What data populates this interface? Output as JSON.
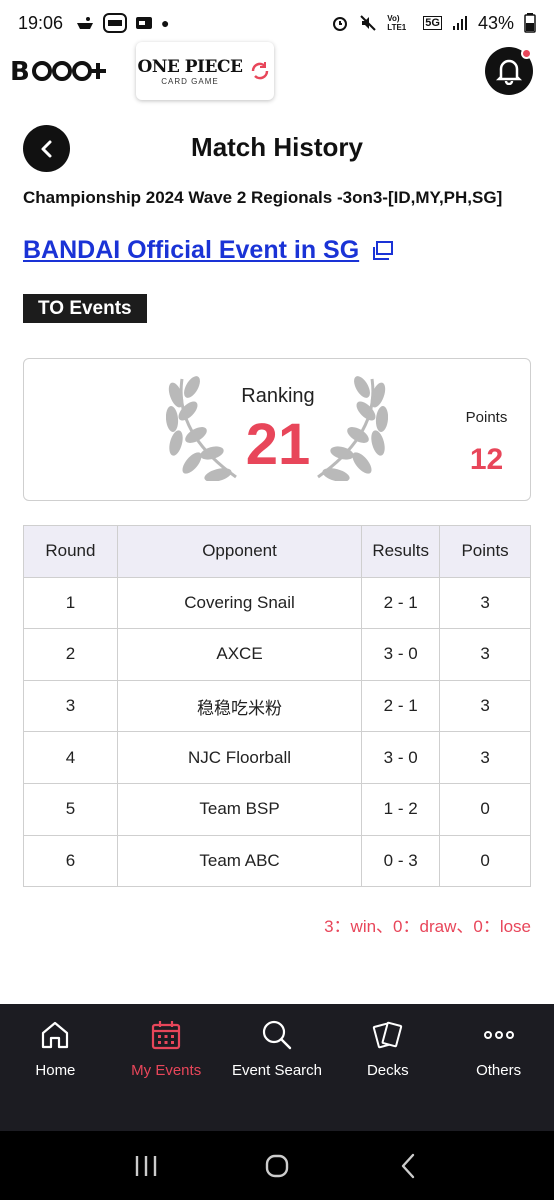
{
  "status_bar": {
    "time": "19:06",
    "network": "5G",
    "lte": "Vo) LTE1",
    "battery": "43%"
  },
  "header": {
    "bandai_logo_text": "B ƀƀ+",
    "op_logo_main": "ONE PIECE",
    "op_logo_sub": "CARD GAME"
  },
  "page": {
    "title": "Match History",
    "event_name": "Championship 2024 Wave 2 Regionals -3on3-[ID,MY,PH,SG]",
    "event_link": "BANDAI Official Event in SG",
    "badge": "TO Events"
  },
  "summary": {
    "ranking_label": "Ranking",
    "ranking_value": "21",
    "points_label": "Points",
    "points_value": "12"
  },
  "table": {
    "headers": [
      "Round",
      "Opponent",
      "Results",
      "Points"
    ],
    "rows": [
      {
        "round": "1",
        "opponent": "Covering Snail",
        "result": "2 - 1",
        "points": "3"
      },
      {
        "round": "2",
        "opponent": "AXCE",
        "result": "3 - 0",
        "points": "3"
      },
      {
        "round": "3",
        "opponent": "稳稳吃米粉",
        "result": "2 - 1",
        "points": "3"
      },
      {
        "round": "4",
        "opponent": "NJC Floorball",
        "result": "3 - 0",
        "points": "3"
      },
      {
        "round": "5",
        "opponent": "Team BSP",
        "result": "1 - 2",
        "points": "0"
      },
      {
        "round": "6",
        "opponent": "Team ABC",
        "result": "0 - 3",
        "points": "0"
      }
    ]
  },
  "legend": "3：win、0：draw、0：lose",
  "nav": {
    "items": [
      {
        "label": "Home",
        "icon": "home-icon"
      },
      {
        "label": "My Events",
        "icon": "calendar-icon"
      },
      {
        "label": "Event Search",
        "icon": "search-icon"
      },
      {
        "label": "Decks",
        "icon": "cards-icon"
      },
      {
        "label": "Others",
        "icon": "more-icon"
      }
    ]
  },
  "colors": {
    "accent": "#e8465a",
    "link": "#1a33d6",
    "nav_bg": "#1c1c22",
    "table_header_bg": "#eeedf6"
  }
}
